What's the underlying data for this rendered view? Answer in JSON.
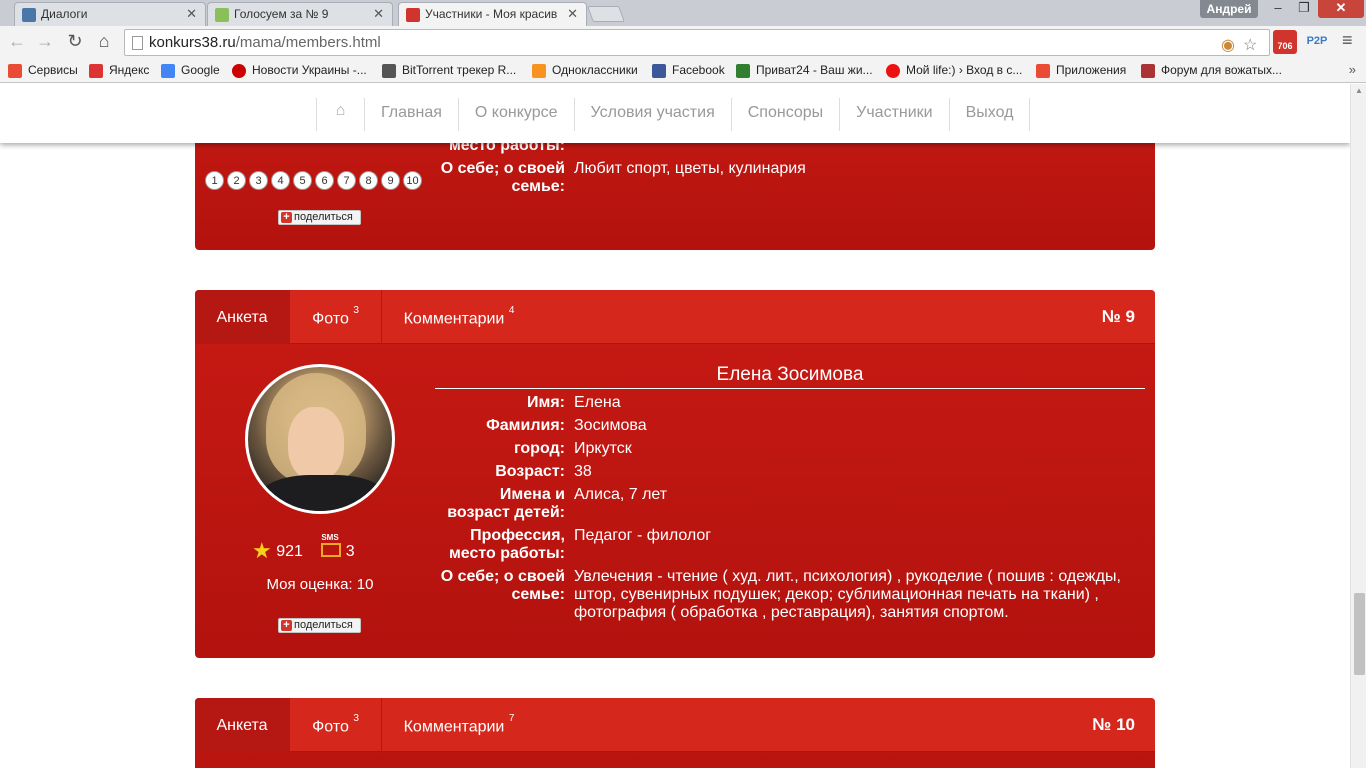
{
  "browser": {
    "tabs": [
      {
        "title": "Диалоги",
        "color": "#4a76a8"
      },
      {
        "title": "Голосуем за № 9",
        "color": "#8bbf5a"
      },
      {
        "title": "Участники - Моя красив",
        "color": "#d0342c"
      }
    ],
    "profile": "Андрей",
    "url_host": "konkurs38.ru",
    "url_path": "/mama/members.html",
    "mail_badge": "706",
    "p2p": "P2P"
  },
  "bookmarks": [
    {
      "label": "Сервисы",
      "color": "#e94b35"
    },
    {
      "label": "Яндекс",
      "color": "#d33"
    },
    {
      "label": "Google",
      "color": "#4285f4"
    },
    {
      "label": "Новости Украины -...",
      "color": "#c00"
    },
    {
      "label": "BitTorrent трекер R...",
      "color": "#555"
    },
    {
      "label": "Одноклассники",
      "color": "#f7931e"
    },
    {
      "label": "Facebook",
      "color": "#3b5998"
    },
    {
      "label": "Приват24 - Ваш жи...",
      "color": "#2f7f2f"
    },
    {
      "label": "Мой life:) › Вход в с...",
      "color": "#e11"
    },
    {
      "label": "Приложения",
      "color": "#e94b35"
    },
    {
      "label": "Форум для вожатых...",
      "color": "#a33"
    }
  ],
  "nav": {
    "items": [
      "Главная",
      "О конкурсе",
      "Условия участия",
      "Спонсоры",
      "Участники",
      "Выход"
    ]
  },
  "card_top": {
    "work_label": "место работы:",
    "about_label": "О себе; о своей семье:",
    "about_value": "Любит спорт, цветы, кулинария",
    "pages": [
      "1",
      "2",
      "3",
      "4",
      "5",
      "6",
      "7",
      "8",
      "9",
      "10"
    ],
    "share": "поделиться"
  },
  "card_mid": {
    "tabs": {
      "anketa": "Анкета",
      "foto": "Фото",
      "foto_count": "3",
      "comments": "Комментарии",
      "comments_count": "4"
    },
    "number": "№ 9",
    "full_name": "Елена Зосимова",
    "fields": [
      {
        "label": "Имя:",
        "value": "Елена"
      },
      {
        "label": "Фамилия:",
        "value": "Зосимова"
      },
      {
        "label": "город:",
        "value": "Иркутск"
      },
      {
        "label": "Возраст:",
        "value": "38"
      },
      {
        "label": "Имена и возраст детей:",
        "value": "Алиса, 7 лет"
      },
      {
        "label": "Профессия, место работы:",
        "value": "Педагог - филолог"
      },
      {
        "label": "О себе; о своей семье:",
        "value": "Увлечения - чтение ( худ. лит., психология) , рукоделие ( пошив : одежды, штор, сувенирных подушек; декор; сублимационная печать на ткани) , фотография ( обработка , реставрация), занятия спортом."
      }
    ],
    "votes": "921",
    "sms": "3",
    "my_rating": "Моя оценка: 10",
    "share": "поделиться"
  },
  "card_bot": {
    "tabs": {
      "anketa": "Анкета",
      "foto": "Фото",
      "foto_count": "3",
      "comments": "Комментарии",
      "comments_count": "7"
    },
    "number": "№ 10"
  }
}
